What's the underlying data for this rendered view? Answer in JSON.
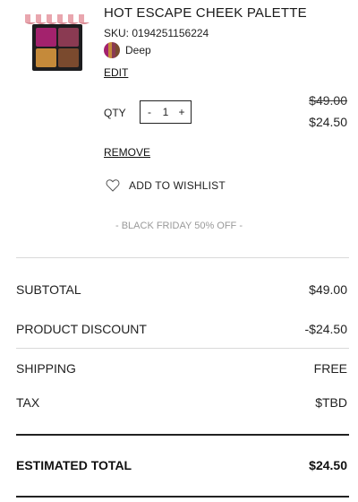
{
  "product": {
    "title": "HOT ESCAPE CHEEK PALETTE",
    "sku": "SKU: 0194251156224",
    "shade": "Deep",
    "edit_label": "EDIT",
    "image_icon": "palette-product-image",
    "colors": {
      "awning_stripe_1": "#e9a6ae",
      "awning_stripe_2": "#ffffff",
      "pan_top_left": "#a3226d",
      "pan_top_right": "#8a3a52",
      "pan_bottom_left": "#c58a3a",
      "pan_bottom_right": "#7a4a2e"
    }
  },
  "quantity": {
    "label": "QTY",
    "minus": "-",
    "value": "1",
    "plus": "+"
  },
  "price": {
    "original": "$49.00",
    "discounted": "$24.50"
  },
  "actions": {
    "remove_label": "REMOVE",
    "wishlist_label": "ADD TO WISHLIST",
    "wishlist_icon": "heart-icon"
  },
  "promo_text": "- BLACK FRIDAY 50% OFF -",
  "summary": {
    "subtotal_label": "SUBTOTAL",
    "subtotal_value": "$49.00",
    "discount_label": "PRODUCT DISCOUNT",
    "discount_value": "-$24.50",
    "shipping_label": "SHIPPING",
    "shipping_value": "FREE",
    "tax_label": "TAX",
    "tax_value": "$TBD",
    "total_label": "ESTIMATED TOTAL",
    "total_value": "$24.50"
  }
}
